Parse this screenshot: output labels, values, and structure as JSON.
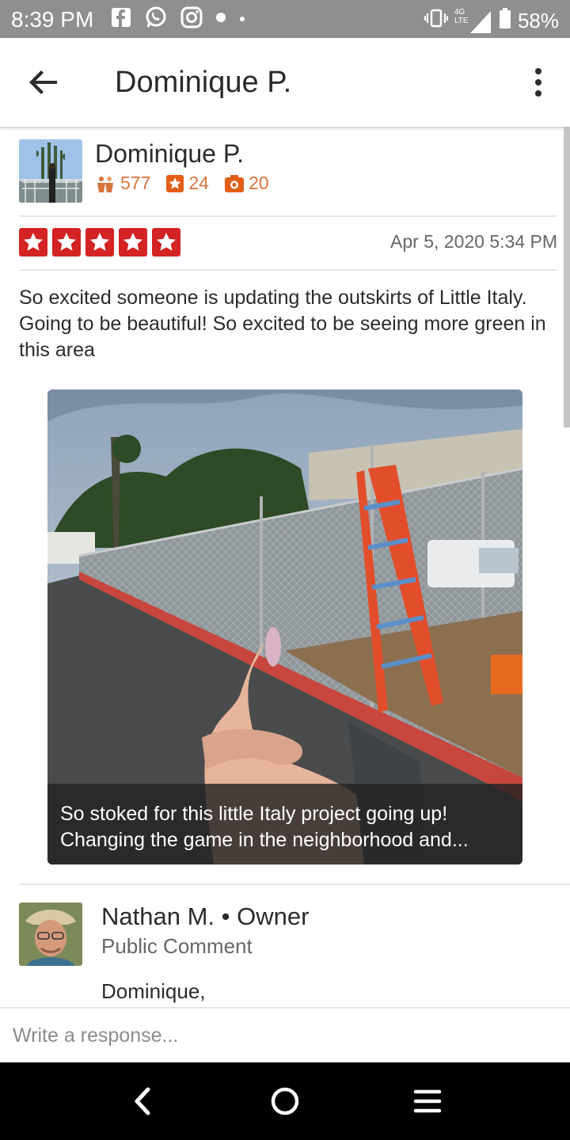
{
  "status_bar": {
    "time": "8:39 PM",
    "network_label": "4G LTE",
    "battery": "58%",
    "left_icons": [
      "facebook-icon",
      "whatsapp-icon",
      "instagram-icon",
      "dot-icon",
      "small-dot-icon"
    ],
    "right_icons": [
      "vibrate-icon",
      "signal-icon",
      "battery-icon"
    ]
  },
  "app_bar": {
    "title": "Dominique P.",
    "back_icon": "arrow-left-icon",
    "menu_icon": "more-vertical-icon"
  },
  "review": {
    "reviewer_name": "Dominique P.",
    "stats": {
      "friends": "577",
      "reviews": "24",
      "photos": "20"
    },
    "rating": 5,
    "rating_max": 5,
    "date": "Apr 5, 2020 5:34 PM",
    "text": "So excited someone is updating the outskirts of Little Italy. Going to be beautiful! So excited to be seeing more green in this area",
    "photo_caption_line1": "So stoked for this little Italy project going up!",
    "photo_caption_line2": "Changing the game in the neighborhood and..."
  },
  "owner_comment": {
    "name": "Nathan M.",
    "separator": " • ",
    "role": "Owner",
    "visibility": "Public Comment",
    "text_start": "Dominique,"
  },
  "response": {
    "placeholder": "Write a response..."
  },
  "nav_bar": {
    "icons": [
      "back-chevron-icon",
      "home-circle-icon",
      "recents-menu-icon"
    ]
  },
  "colors": {
    "status_bar": "#8f8f8f",
    "star_red": "#d32323",
    "stat_orange": "#d8743d",
    "text_dark": "#2b2b2b",
    "text_gray": "#666666"
  }
}
